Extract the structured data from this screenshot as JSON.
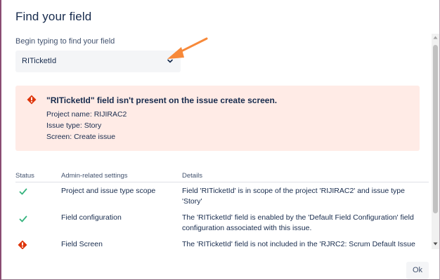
{
  "dialog": {
    "title": "Find your field",
    "search_label": "Begin typing to find your field",
    "selected_field": "RITicketId"
  },
  "alert": {
    "heading": "\"RITicketId\" field isn't present on the issue create screen.",
    "project": "Project name: RIJIRAC2",
    "issue_type": "Issue type: Story",
    "screen": "Screen: Create issue"
  },
  "table": {
    "headers": [
      "Status",
      "Admin-related settings",
      "Details"
    ],
    "rows": [
      {
        "status": "ok",
        "setting": "Project and issue type scope",
        "details": "Field 'RITicketId' is in scope of the project 'RIJIRAC2' and issue type 'Story'"
      },
      {
        "status": "ok",
        "setting": "Field configuration",
        "details": "The 'RITicketId' field is enabled by the 'Default Field Configuration' field configuration associated with this issue."
      },
      {
        "status": "error",
        "setting": "Field Screen",
        "details": "The 'RITicketId' field is not included in the 'RJRC2: Scrum Default Issue"
      }
    ]
  },
  "footer": {
    "ok_label": "Ok"
  },
  "colors": {
    "alert_bg": "#ffebe6",
    "error_red": "#de350b",
    "success_green": "#36b37e",
    "annotation_orange": "#f7893a"
  },
  "icons": {
    "dropdown": "chevron-down-icon",
    "error": "error-icon",
    "success": "check-icon",
    "annotation": "arrow-icon"
  }
}
